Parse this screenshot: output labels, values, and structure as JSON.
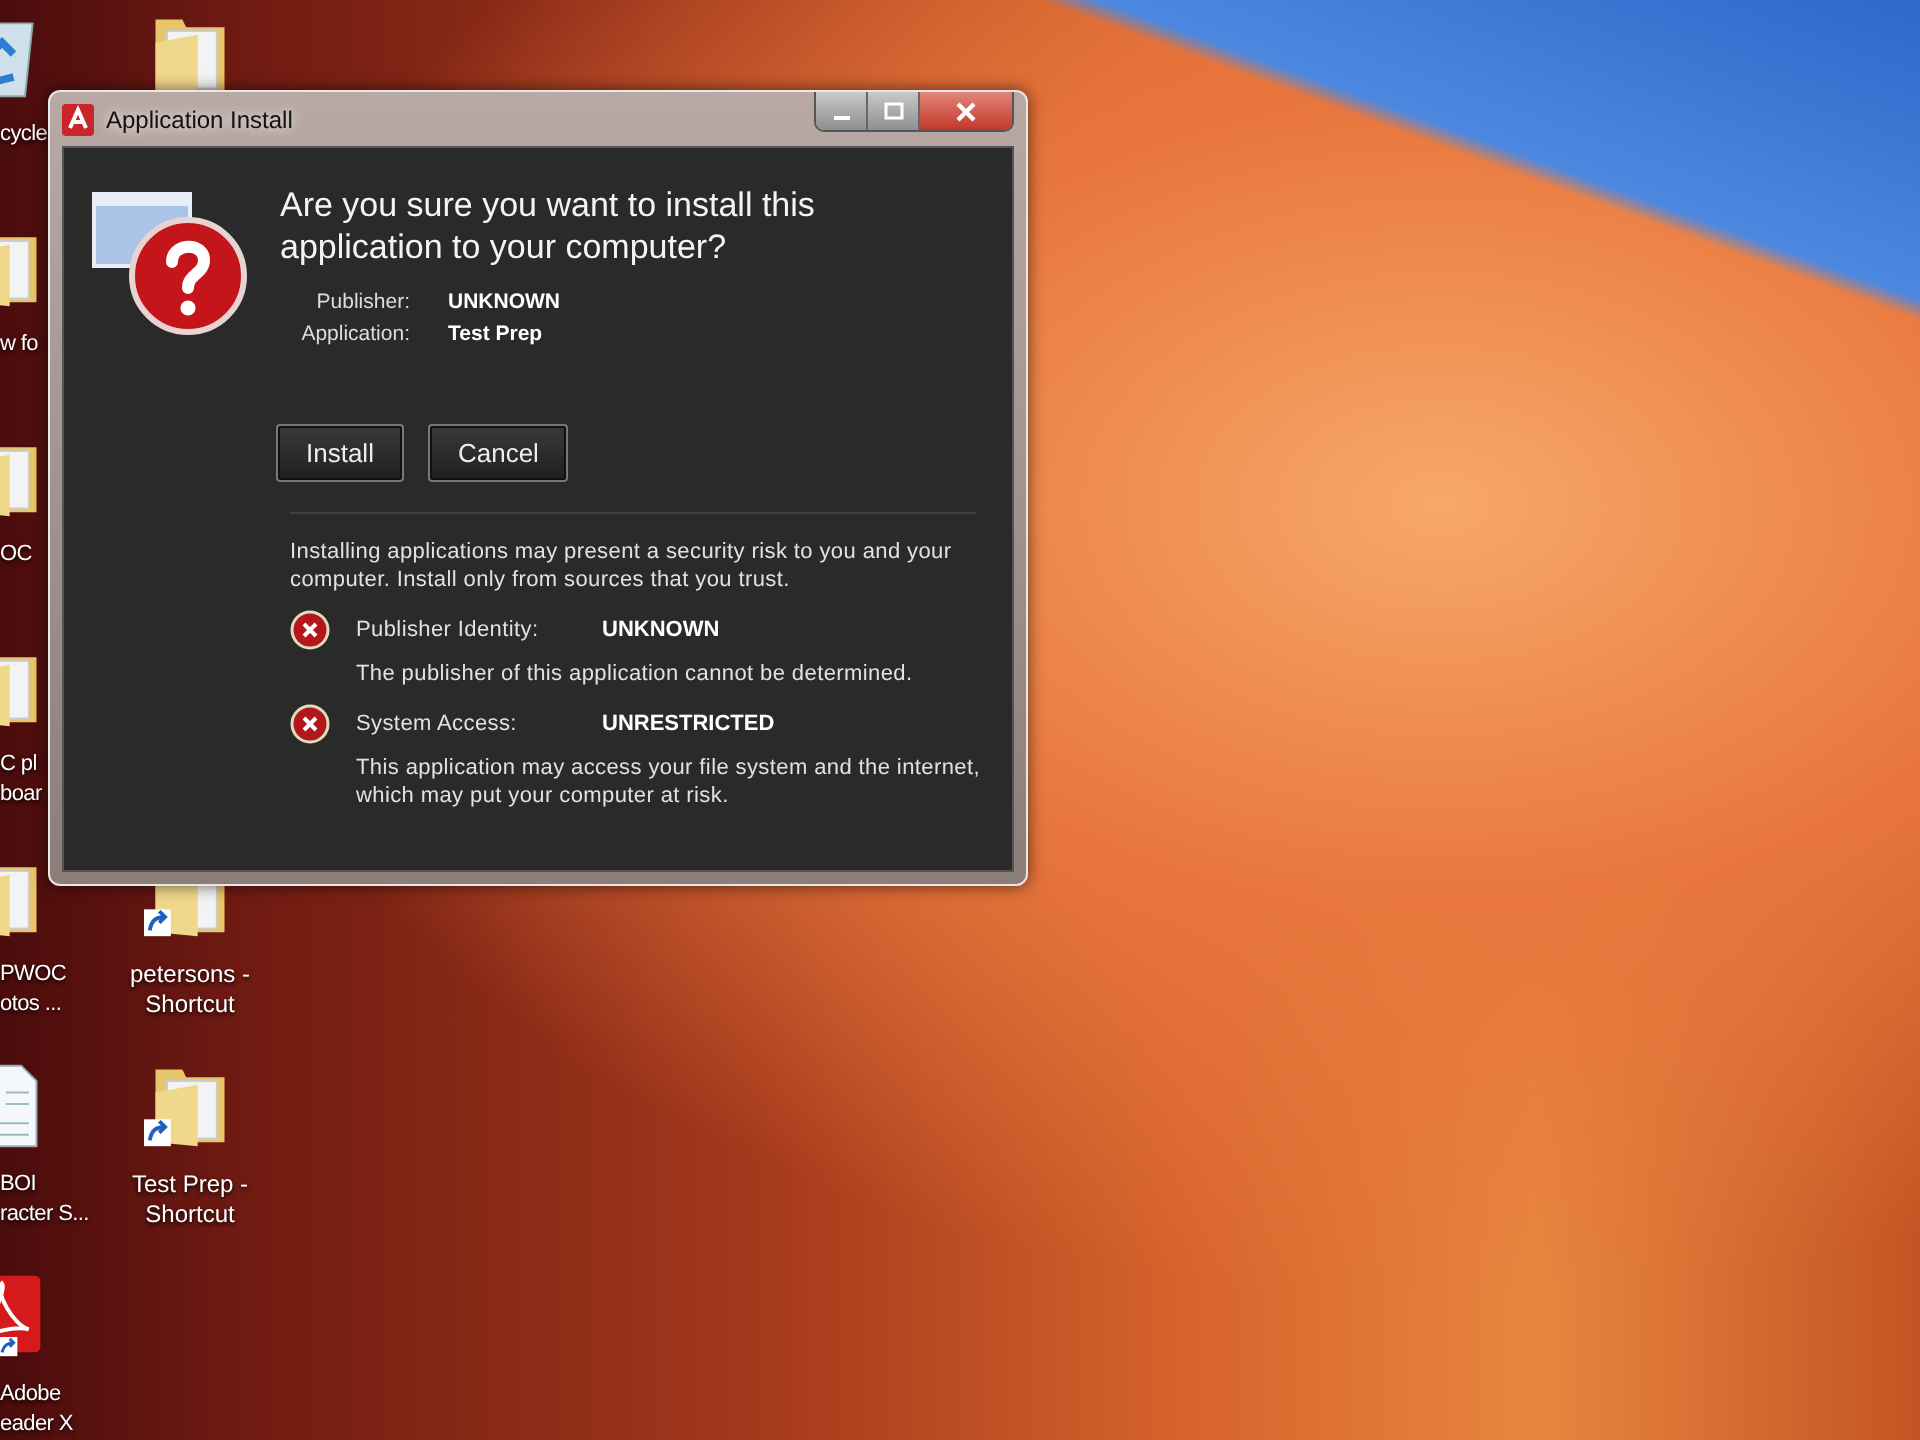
{
  "desktop_icons": [
    {
      "kind": "recycle-bin",
      "lines": [
        "cycle"
      ]
    },
    {
      "kind": "folder",
      "lines": [
        "w fo"
      ]
    },
    {
      "kind": "folder",
      "lines": [
        "OC"
      ]
    },
    {
      "kind": "folder",
      "lines": [
        "C pl",
        "boar"
      ]
    },
    {
      "kind": "folder",
      "lines": [
        "PWOC",
        "otos ..."
      ]
    },
    {
      "kind": "document",
      "lines": [
        "BOI",
        "racter S..."
      ]
    },
    {
      "kind": "pdf",
      "shortcut": true,
      "lines": [
        "Adobe",
        "eader X"
      ]
    }
  ],
  "desktop_icons_column_2": [
    {
      "kind": "folder",
      "shortcut": false
    },
    {
      "kind": "folder",
      "shortcut": true,
      "lines": [
        "petersons -",
        "Shortcut"
      ]
    },
    {
      "kind": "folder",
      "shortcut": true,
      "lines": [
        "Test Prep -",
        "Shortcut"
      ]
    }
  ],
  "window": {
    "title": "Application Install",
    "heading": "Are you sure you want to install this application to your computer?",
    "details": [
      {
        "label": "Publisher:",
        "value": "UNKNOWN"
      },
      {
        "label": "Application:",
        "value": "Test Prep"
      }
    ],
    "buttons": [
      "Install",
      "Cancel"
    ],
    "warning": "Installing applications may present a security risk to you and your computer. Install only from sources that you trust.",
    "risks": [
      {
        "label": "Publisher Identity:",
        "value": "UNKNOWN",
        "description": "The publisher of this application cannot be determined."
      },
      {
        "label": "System Access:",
        "value": "UNRESTRICTED",
        "description": "This application may access your file system and the internet, which may put your computer at risk."
      }
    ]
  }
}
